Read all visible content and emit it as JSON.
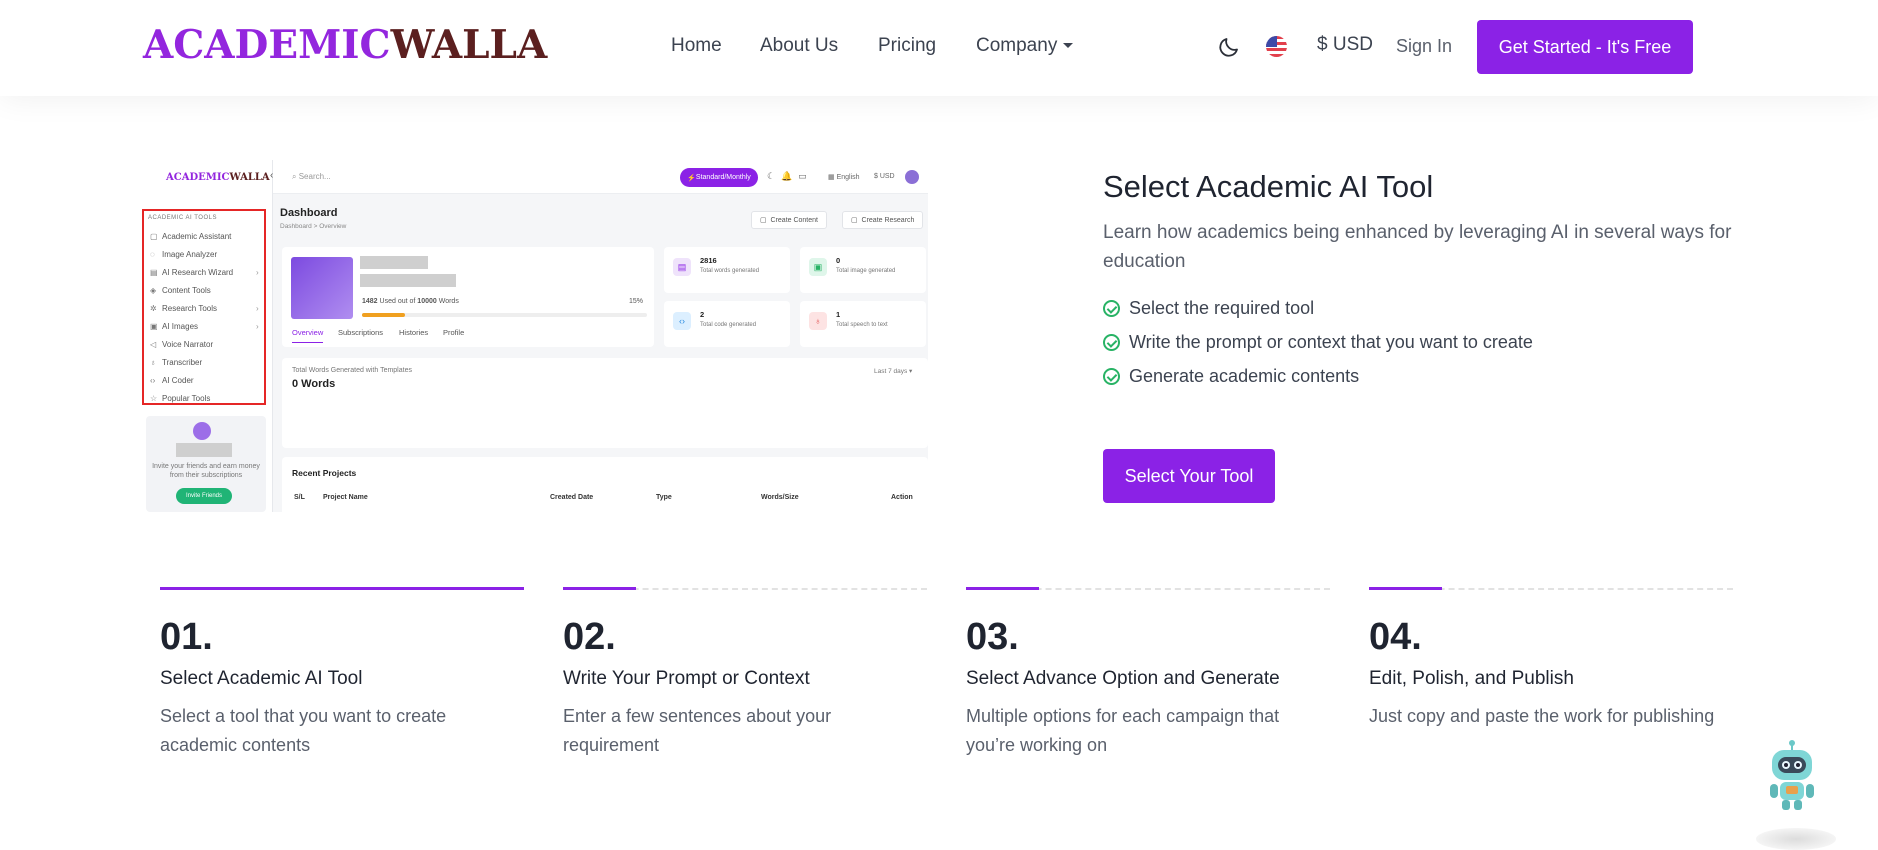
{
  "header": {
    "logo_part1": "ACADEMIC",
    "logo_part2": "WALLA",
    "nav": [
      "Home",
      "About Us",
      "Pricing",
      "Company"
    ],
    "currency": "$ USD",
    "sign_in": "Sign In",
    "cta": "Get Started - It's Free"
  },
  "dashboard": {
    "logo_part1": "ACADEMIC",
    "logo_part2": "WALLA",
    "search_placeholder": "Search...",
    "plan_badge": "Standard/Monthly",
    "language": "English",
    "currency": "$ USD",
    "tools_title": "ACADEMIC AI TOOLS",
    "tools": [
      "Academic Assistant",
      "Image Analyzer",
      "AI Research Wizard",
      "Content Tools",
      "Research Tools",
      "AI Images",
      "Voice Narrator",
      "Transcriber",
      "AI Coder",
      "Popular Tools"
    ],
    "invite_text": "Invite your friends and earn money from their subscriptions",
    "invite_button": "Invite Friends",
    "title": "Dashboard",
    "crumb_1": "Dashboard",
    "crumb_2": "Overview",
    "create_content": "Create Content",
    "create_research": "Create Research",
    "usage_used": "1482",
    "usage_mid": "Used out of",
    "usage_total": "10000",
    "usage_unit": "Words",
    "usage_pct": "15%",
    "usage_fraction": 0.15,
    "tabs": [
      "Overview",
      "Subscriptions",
      "Histories",
      "Profile"
    ],
    "stats": [
      {
        "value": "2816",
        "label": "Total words generated"
      },
      {
        "value": "0",
        "label": "Total image generated"
      },
      {
        "value": "2",
        "label": "Total code generated"
      },
      {
        "value": "1",
        "label": "Total speech to text"
      }
    ],
    "chart_title": "Total Words Generated with Templates",
    "chart_value": "0 Words",
    "chart_range": "Last 7 days",
    "recent_title": "Recent Projects",
    "recent_cols": [
      "S/L",
      "Project Name",
      "Created Date",
      "Type",
      "Words/Size",
      "Action"
    ]
  },
  "hero": {
    "title": "Select Academic AI Tool",
    "lead": "Learn how academics being enhanced by leveraging AI in several ways for education",
    "bullets": [
      "Select the required tool",
      "Write the prompt or context that you want to create",
      "Generate academic contents"
    ],
    "button": "Select Your Tool"
  },
  "steps": [
    {
      "num": "01.",
      "title": "Select Academic AI Tool",
      "desc": "Select a tool that you want to create academic contents",
      "progress": 1.0
    },
    {
      "num": "02.",
      "title": "Write Your Prompt or Context",
      "desc": "Enter a few sentences about your requirement",
      "progress": 0.2
    },
    {
      "num": "03.",
      "title": "Select Advance Option and Generate",
      "desc": "Multiple options for each campaign that you’re working on",
      "progress": 0.2
    },
    {
      "num": "04.",
      "title": "Edit, Polish, and Publish",
      "desc": "Just copy and paste the work for publishing",
      "progress": 0.2
    }
  ],
  "colors": {
    "accent": "#8b22e6",
    "logo_dark": "#5b1f1f",
    "check": "#28b365"
  }
}
